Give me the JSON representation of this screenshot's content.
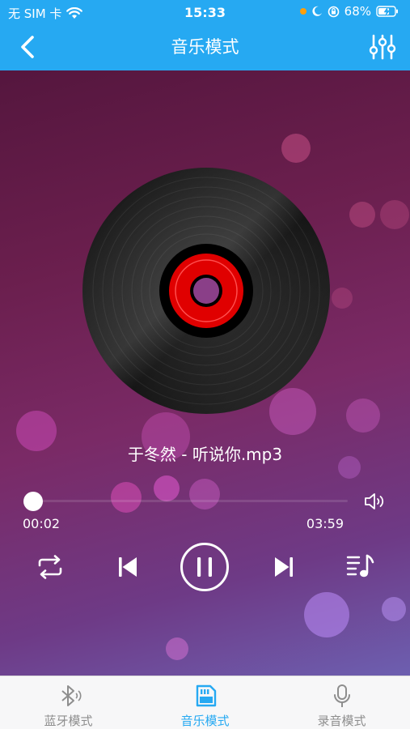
{
  "status_bar": {
    "carrier": "无 SIM 卡",
    "time": "15:33",
    "battery": "68%"
  },
  "nav": {
    "title": "音乐模式",
    "back_icon": "chevron-left-icon",
    "settings_icon": "equalizer-sliders-icon"
  },
  "player": {
    "song_title": "于冬然 - 听说你.mp3",
    "current_time": "00:02",
    "total_time": "03:59",
    "progress": 0.008,
    "state": "playing"
  },
  "controls": [
    "repeat-icon",
    "previous-icon",
    "pause-icon",
    "next-icon",
    "playlist-icon"
  ],
  "tabs": [
    {
      "label": "蓝牙模式",
      "icon": "bluetooth-icon",
      "active": false
    },
    {
      "label": "音乐模式",
      "icon": "sd-card-icon",
      "active": true
    },
    {
      "label": "录音模式",
      "icon": "microphone-icon",
      "active": false
    }
  ],
  "colors": {
    "accent": "#26a9f2",
    "inactive_tab": "#8e8e8e",
    "record_label": "#e00000"
  }
}
